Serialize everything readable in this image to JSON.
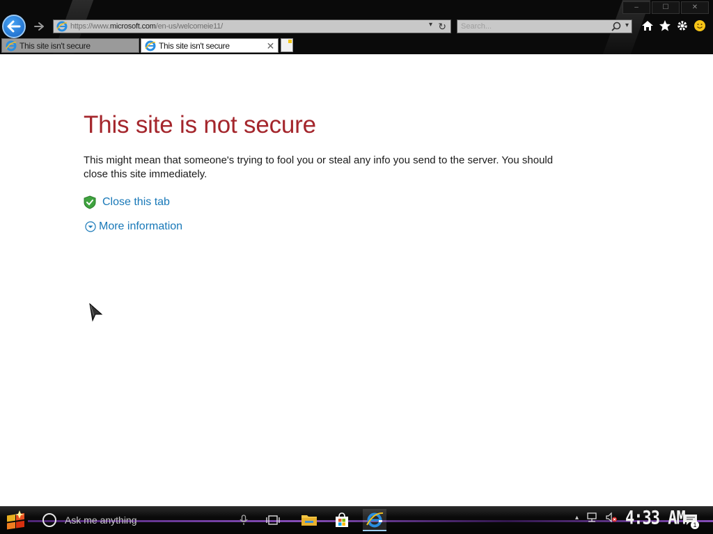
{
  "browser": {
    "address_url_prefix": "https://www.",
    "address_url_domain": "microsoft.com",
    "address_url_path": "/en-us/welcomeie11/",
    "search_placeholder": "Search...",
    "tabs": [
      {
        "label": "This site isn't secure",
        "active": false
      },
      {
        "label": "This site isn't secure",
        "active": true
      }
    ],
    "tab_close_glyph": "✕",
    "window_buttons": [
      "–",
      "☐",
      "✕"
    ]
  },
  "page": {
    "title": "This site is not secure",
    "body": "This might mean that someone's trying to fool you or steal any info you send to the server. You should close this site immediately.",
    "close_link": "Close this tab",
    "more_info_link": "More information"
  },
  "taskbar": {
    "search_placeholder": "Ask me anything",
    "clock": "4:33 AM",
    "notification_count": "1"
  },
  "icons": {
    "back": "back-arrow-icon",
    "forward": "forward-arrow-icon",
    "home": "home-icon",
    "favorites": "star-icon",
    "tools": "gear-icon",
    "feedback": "smiley-icon"
  },
  "colors": {
    "title_red": "#a4262c",
    "link_blue": "#1878b8",
    "taskbar_purple": "#9b59d6"
  }
}
